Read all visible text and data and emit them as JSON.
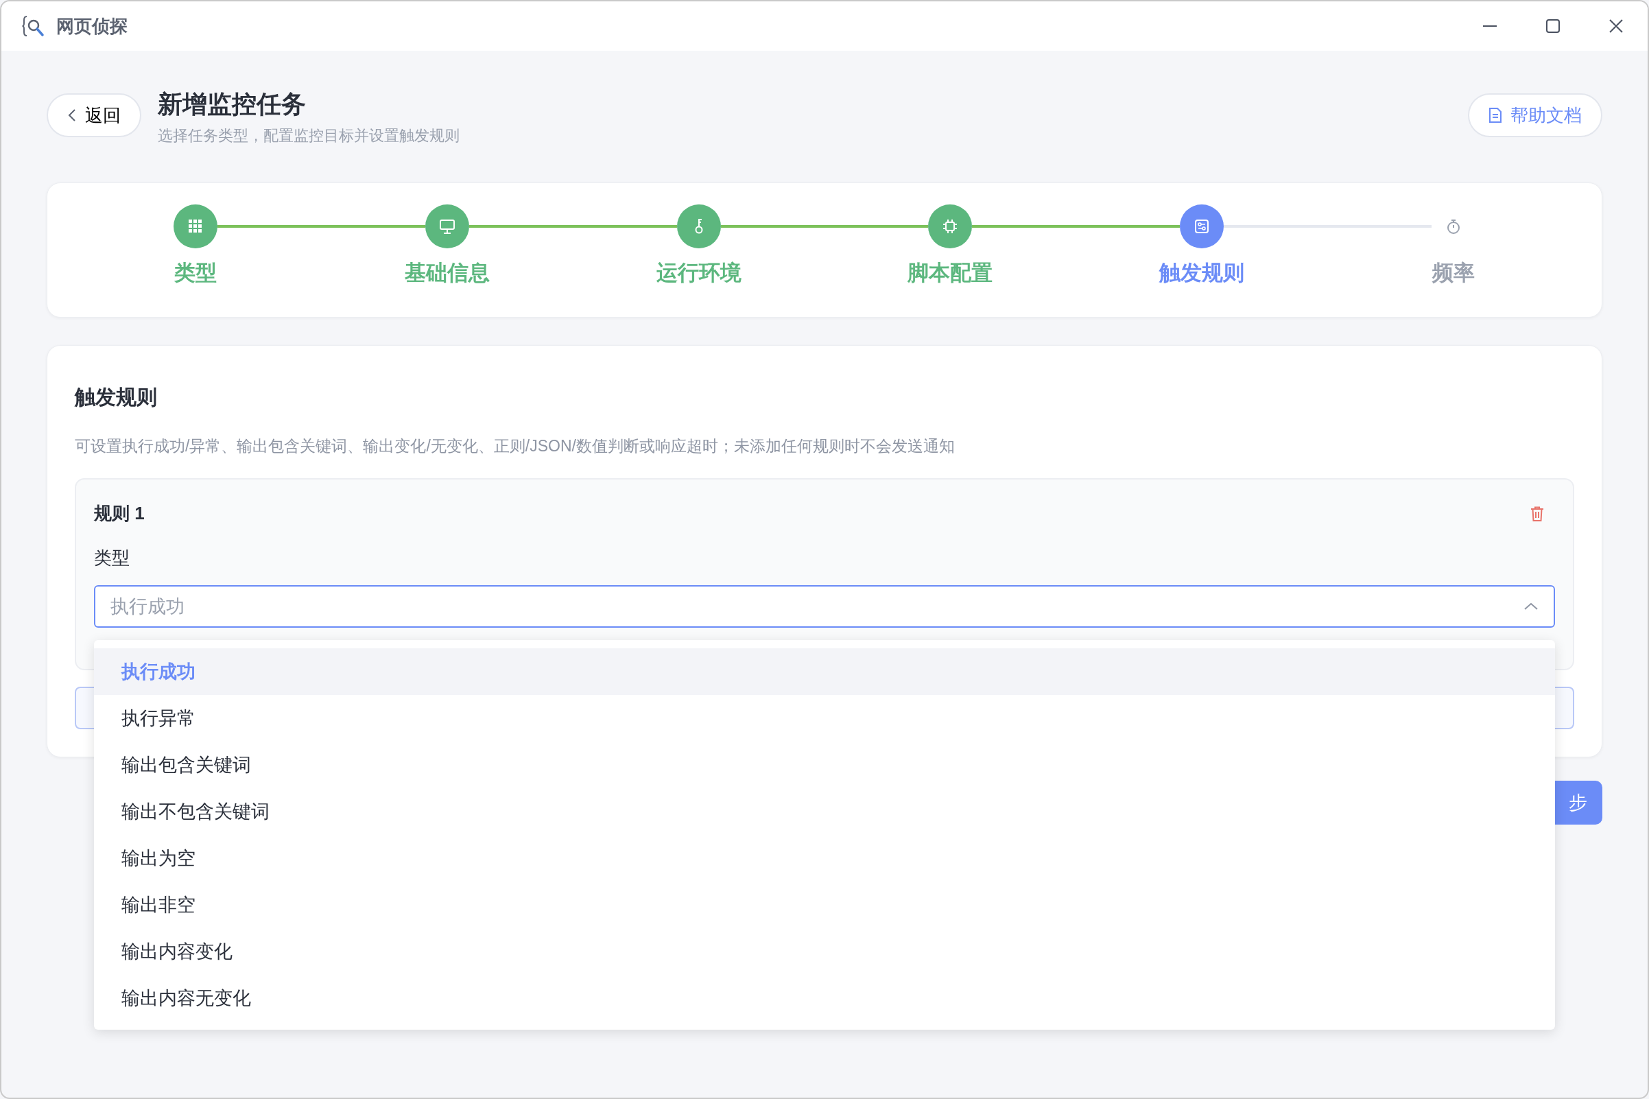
{
  "window": {
    "title": "网页侦探"
  },
  "header": {
    "back_button": "返回",
    "title": "新增监控任务",
    "subtitle": "选择任务类型，配置监控目标并设置触发规则",
    "help_button": "帮助文档"
  },
  "steps": [
    {
      "label": "类型",
      "done": true,
      "selected": false
    },
    {
      "label": "基础信息",
      "done": true,
      "selected": false
    },
    {
      "label": "运行环境",
      "done": true,
      "selected": false
    },
    {
      "label": "脚本配置",
      "done": true,
      "selected": false
    },
    {
      "label": "触发规则",
      "done": false,
      "selected": true
    },
    {
      "label": "频率",
      "done": false,
      "selected": false
    }
  ],
  "section": {
    "title": "触发规则",
    "description": "可设置执行成功/异常、输出包含关键词、输出变化/无变化、正则/JSON/数值判断或响应超时；未添加任何规则时不会发送通知"
  },
  "rules": [
    {
      "title": "规则 1",
      "type_label": "类型",
      "type_value": "执行成功",
      "expanded": true
    }
  ],
  "dropdown_options": [
    {
      "label": "执行成功",
      "selected": true
    },
    {
      "label": "执行异常",
      "selected": false
    },
    {
      "label": "输出包含关键词",
      "selected": false
    },
    {
      "label": "输出不包含关键词",
      "selected": false
    },
    {
      "label": "输出为空",
      "selected": false
    },
    {
      "label": "输出非空",
      "selected": false
    },
    {
      "label": "输出内容变化",
      "selected": false
    },
    {
      "label": "输出内容无变化",
      "selected": false
    }
  ],
  "next_button": "步"
}
